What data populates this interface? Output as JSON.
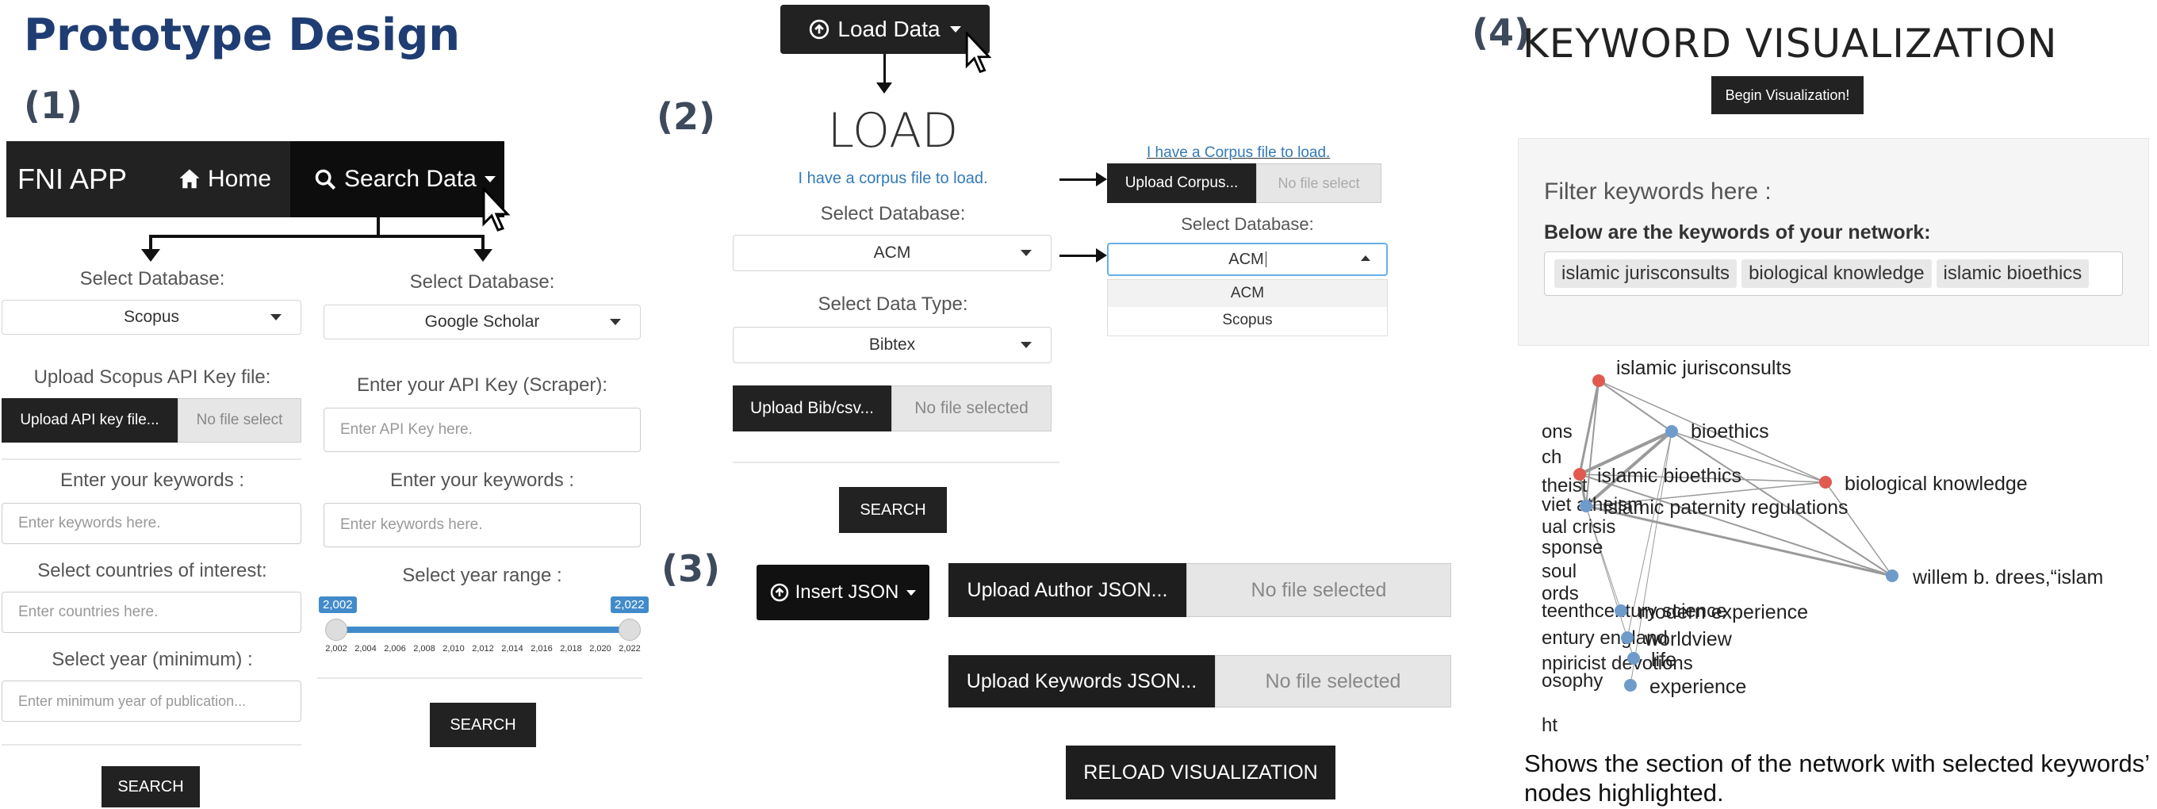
{
  "header": {
    "title": "Prototype Design"
  },
  "panel1": {
    "number": "(1)",
    "navbar": {
      "brand": "FNI APP",
      "home": "Home",
      "search": "Search Data"
    },
    "left": {
      "db_label": "Select Database:",
      "db_value": "Scopus",
      "api_label": "Upload Scopus API Key file:",
      "upload_btn": "Upload API key file...",
      "file_status": "No file select",
      "kw_label": "Enter your keywords :",
      "kw_placeholder": "Enter keywords here.",
      "countries_label": "Select countries of interest:",
      "countries_placeholder": "Enter countries here.",
      "year_label": "Select year (minimum) :",
      "year_placeholder": "Enter minimum year of publication...",
      "search": "SEARCH"
    },
    "right": {
      "db_label": "Select Database:",
      "db_value": "Google Scholar",
      "api_label": "Enter your API Key (Scraper):",
      "api_placeholder": "Enter API Key here.",
      "kw_label": "Enter your keywords :",
      "kw_placeholder": "Enter keywords here.",
      "year_label": "Select year range :",
      "slider": {
        "min_badge": "2,002",
        "max_badge": "2,022",
        "min": 2002,
        "max": 2022,
        "low": 2002,
        "high": 2022,
        "ticks": [
          "2,002",
          "2,004",
          "2,006",
          "2,008",
          "2,010",
          "2,012",
          "2,014",
          "2,016",
          "2,018",
          "2,020",
          "2,022"
        ]
      },
      "search": "SEARCH"
    }
  },
  "panel2": {
    "number": "(2)",
    "load_btn": "Load Data",
    "heading": "LOAD",
    "corpus_link": "I have a corpus file to load.",
    "db_label": "Select Database:",
    "db_value": "ACM",
    "type_label": "Select Data Type:",
    "type_value": "Bibtex",
    "upload_btn": "Upload Bib/csv...",
    "file_status": "No file selected",
    "search": "SEARCH",
    "expanded": {
      "link": "I have a Corpus file to load.",
      "upload_btn": "Upload Corpus...",
      "file_status": "No file select",
      "db_label": "Select Database:",
      "db_value": "ACM",
      "options": [
        "ACM",
        "Scopus"
      ]
    }
  },
  "panel3": {
    "number": "(3)",
    "insert_btn": "Insert JSON",
    "author_btn": "Upload Author JSON...",
    "author_status": "No file selected",
    "keywords_btn": "Upload Keywords JSON...",
    "keywords_status": "No file selected",
    "reload": "RELOAD VISUALIZATION"
  },
  "panel4": {
    "number": "(4)",
    "heading": "KEYWORD VISUALIZATION",
    "begin": "Begin Visualization!",
    "filter_title": "Filter keywords here :",
    "network_label": "Below are the keywords of your network:",
    "chips": [
      "islamic jurisconsults",
      "biological knowledge",
      "islamic bioethics"
    ],
    "caption": "Shows the section of the network with selected keywords’ nodes highlighted.",
    "nodes": [
      "islamic jurisconsults",
      "bioethics",
      "islamic bioethics",
      "biological knowledge",
      "islamic paternity regulations",
      "willem b. drees,“islam",
      "modern experience",
      "worldview",
      "life",
      "experience"
    ],
    "edge_fragments": [
      "ons",
      "ch",
      "theist",
      "viet atheism",
      "ual crisis",
      "sponse",
      "soul",
      "ords",
      "teenthcentury science",
      "entury england",
      "npiricist devotions",
      "osophy",
      "ht"
    ],
    "colors": {
      "highlight": "#e05a4f",
      "normal": "#6f9bcb",
      "edge": "#9a9a9a"
    }
  }
}
